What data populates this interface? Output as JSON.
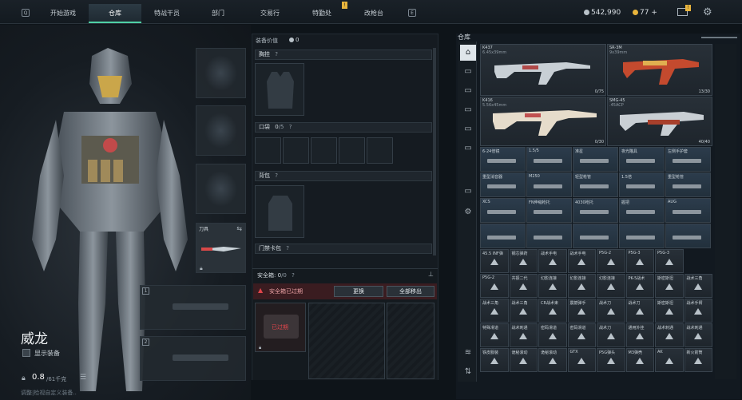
{
  "nav": {
    "left_key": "Q",
    "right_key": "E",
    "tabs": [
      {
        "label": "开始游戏"
      },
      {
        "label": "仓库"
      },
      {
        "label": "特战干员"
      },
      {
        "label": "部门"
      },
      {
        "label": "交易行"
      },
      {
        "label": "特勤处"
      },
      {
        "label": "改枪台"
      }
    ],
    "badge": "!",
    "currency": {
      "amount1": "542,990",
      "amount2": "77",
      "plus": "+"
    },
    "mail_badge": "!"
  },
  "character": {
    "name": "威龙",
    "show_gear_label": "显示装备",
    "weight_value": "0.8",
    "weight_unit": "/61千克",
    "footnote": "调整|检视自定义装备..",
    "slot_item_label": "刀具",
    "slot_index_1": "1",
    "slot_index_2": "2"
  },
  "loadout": {
    "value_label": "装备价值",
    "value_amount": "0",
    "chest_label": "胸挂",
    "pockets_label": "口袋",
    "pockets_count": "0",
    "pockets_max": "/5",
    "backpack_label": "背包",
    "keycard_label": "门禁卡包",
    "safe_label": "安全箱",
    "safe_count": "0",
    "safe_max": "/0",
    "help": "?",
    "safe_warning": "安全箱已过期",
    "replace_button": "更换",
    "remove_all_button": "全部移出",
    "expired_tag": "已过期"
  },
  "warehouse": {
    "title": "仓库",
    "title2": "仓库",
    "weapons": [
      {
        "name": "K437",
        "sub": "6.45x39mm",
        "count": "0/75"
      },
      {
        "name": "SR-3M",
        "sub": "9x39mm",
        "count": "13/30"
      },
      {
        "name": "K416",
        "sub": "5.56x45mm",
        "count": "0/30"
      },
      {
        "name": "SMG-45",
        "sub": ".45ACP",
        "count": "40/40"
      }
    ],
    "parts_row1": [
      "6-24倍镜",
      "1.5/5",
      "准星",
      "夜光瞄具",
      "左侧手护套"
    ],
    "parts_row2": [
      "重型消音器",
      "M250",
      "轻型枪管",
      "1.5倍",
      "重型枪管"
    ],
    "parts_row3": [
      "XCS",
      "FN伸缩枪托",
      "4030枪托",
      "握把",
      "AUG"
    ],
    "parts_row4": [
      "",
      "",
      "",
      "",
      ""
    ],
    "ammo_row1": [
      "45.5 INF弹",
      "钢芯弹药",
      "战术手电",
      "战术手电",
      "P5G-2",
      "P5G-3",
      "P5G-3"
    ],
    "ammo_row2": [
      "P5G-2",
      "共振二代",
      "幻影连接",
      "幻影连接",
      "幻影连接",
      "PK-5战术",
      "斯密斯坦",
      "战术三角"
    ],
    "ammo_row3": [
      "战术三角",
      "战术三角",
      "CR战术束",
      "震撼弹手",
      "战术刀",
      "战术刀",
      "斯密斯坦",
      "战术手臂"
    ],
    "ammo_row4": [
      "特殊滑道",
      "战术刺通",
      "密码滑道",
      "密码滑道",
      "战术刀",
      "通用外挂",
      "战术刺通",
      "战术刺通"
    ],
    "ammo_row5": [
      "铁皮服装",
      "诡秘滚动",
      "诡秘滚动",
      "GTX",
      "P5G弹头",
      "M3弹壳",
      "AK",
      "新火箭筒"
    ]
  },
  "colors": {
    "accent": "#4fd1a5",
    "warning": "#e0454b",
    "gold": "#e8b43c"
  },
  "icons": {
    "settings": "gear-icon",
    "mail": "mail-icon",
    "lock": "lock-icon",
    "pin": "pin-icon"
  }
}
